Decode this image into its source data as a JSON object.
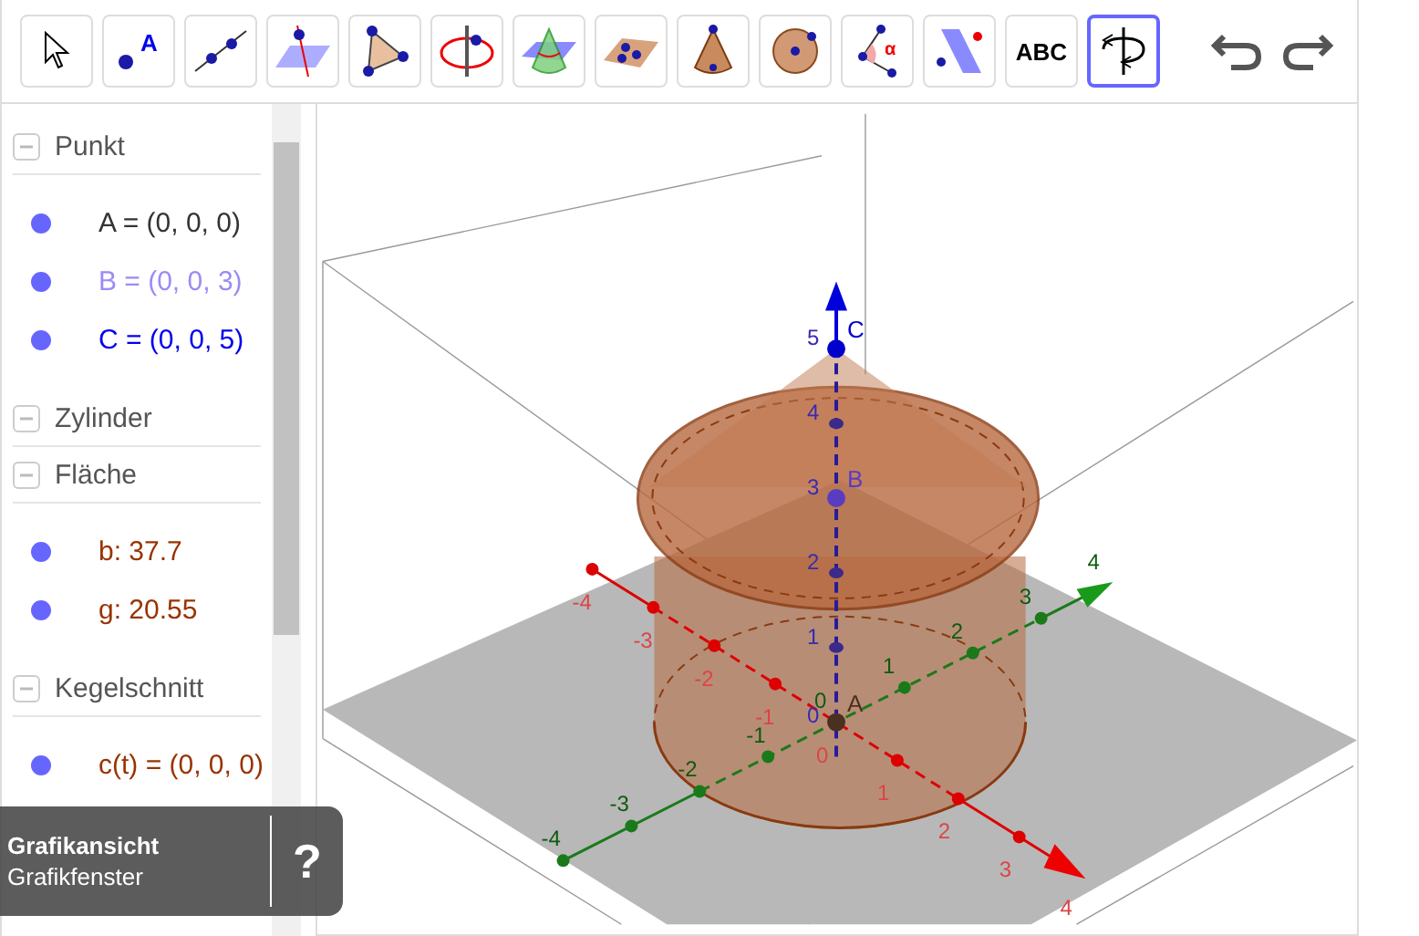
{
  "toolbar": {
    "tools": [
      {
        "kind": "move",
        "selected": false
      },
      {
        "kind": "point",
        "selected": false,
        "label": "A"
      },
      {
        "kind": "line",
        "selected": false
      },
      {
        "kind": "plane-line",
        "selected": false
      },
      {
        "kind": "triangle",
        "selected": false
      },
      {
        "kind": "circle-axis",
        "selected": false
      },
      {
        "kind": "cone-plane",
        "selected": false
      },
      {
        "kind": "plane-points",
        "selected": false
      },
      {
        "kind": "cone",
        "selected": false
      },
      {
        "kind": "sphere",
        "selected": false
      },
      {
        "kind": "angle",
        "selected": false,
        "label": "α"
      },
      {
        "kind": "plane-point",
        "selected": false
      },
      {
        "kind": "text",
        "selected": false,
        "label": "ABC"
      },
      {
        "kind": "rotate",
        "selected": true
      }
    ]
  },
  "algebra": {
    "groups": [
      {
        "title": "Punkt",
        "expanded": true,
        "items": [
          {
            "text": "A = (0, 0, 0)",
            "color": "#333333",
            "visible": true
          },
          {
            "text": "B = (0, 0, 3)",
            "color": "#9a8cf5",
            "visible": true
          },
          {
            "text": "C = (0, 0, 5)",
            "color": "#0000ee",
            "visible": true
          }
        ]
      },
      {
        "title": "Zylinder",
        "expanded": true
      },
      {
        "title": "Fläche",
        "expanded": true,
        "items": [
          {
            "text": "b: 37.7",
            "color": "#993300",
            "visible": true
          },
          {
            "text": "g: 20.55",
            "color": "#993300",
            "visible": true
          }
        ]
      },
      {
        "title": "Kegelschnitt",
        "expanded": true,
        "items": [
          {
            "text": "c(t) = (0, 0, 0)",
            "color": "#993300",
            "visible": true
          }
        ]
      }
    ]
  },
  "graphics": {
    "points": [
      {
        "label": "C",
        "color": "#0000cc"
      },
      {
        "label": "B",
        "color": "#5a3cc0"
      },
      {
        "label": "A",
        "color": "#4a3020"
      }
    ],
    "x_axis_labels": [
      "-4",
      "-3",
      "-2",
      "-1",
      "0",
      "1",
      "2",
      "3",
      "4"
    ],
    "y_axis_labels": [
      "-4",
      "-3",
      "-2",
      "-1",
      "0",
      "1",
      "2",
      "3",
      "4"
    ],
    "z_axis_labels": [
      "5",
      "4",
      "3",
      "2",
      "1",
      "0"
    ]
  },
  "tooltip": {
    "title": "Grafikansicht",
    "subtitle": "Grafikfenster",
    "help": "?"
  }
}
